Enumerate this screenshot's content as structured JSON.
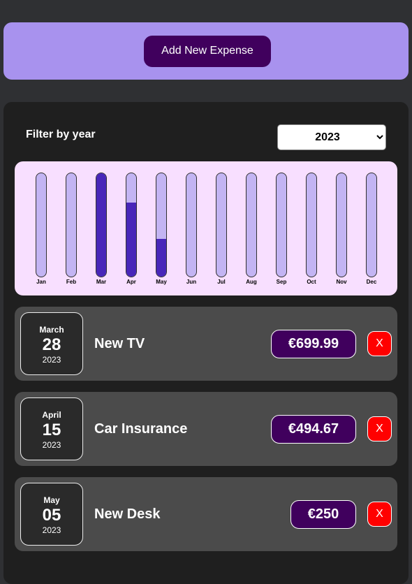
{
  "new_expense": {
    "button_label": "Add New Expense"
  },
  "filter": {
    "label": "Filter by year",
    "selected_year": "2023"
  },
  "chart_data": {
    "type": "bar",
    "categories": [
      "Jan",
      "Feb",
      "Mar",
      "Apr",
      "May",
      "Jun",
      "Jul",
      "Aug",
      "Sep",
      "Oct",
      "Nov",
      "Dec"
    ],
    "values": [
      0,
      0,
      699.99,
      494.67,
      250,
      0,
      0,
      0,
      0,
      0,
      0,
      0
    ],
    "max": 699.99,
    "colors": {
      "track": "#c3b4f3",
      "fill": "#4826b9",
      "background": "#f8dfff"
    }
  },
  "expenses": [
    {
      "month": "March",
      "day": "28",
      "year": "2023",
      "title": "New TV",
      "amount": "€699.99",
      "delete_label": "X"
    },
    {
      "month": "April",
      "day": "15",
      "year": "2023",
      "title": "Car Insurance",
      "amount": "€494.67",
      "delete_label": "X"
    },
    {
      "month": "May",
      "day": "05",
      "year": "2023",
      "title": "New Desk",
      "amount": "€250",
      "delete_label": "X"
    }
  ],
  "colors": {
    "accent": "#40005d",
    "panel": "#a892ee",
    "delete": "#ff0000"
  }
}
